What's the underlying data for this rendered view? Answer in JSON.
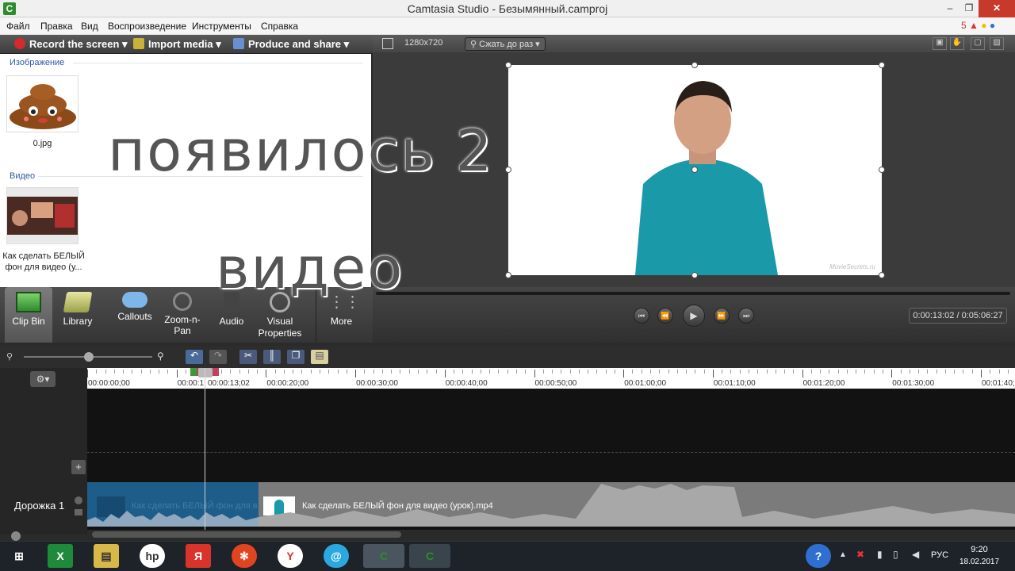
{
  "window": {
    "title": "Camtasia Studio - Безымянный.camproj",
    "logo_letter": "C"
  },
  "menu": {
    "items": [
      "Файл",
      "Правка",
      "Вид",
      "Воспроизведение",
      "Инструменты",
      "Справка"
    ],
    "notify_count": "5"
  },
  "toolbar": {
    "record_label": "Record the screen",
    "import_label": "Import media",
    "produce_label": "Produce and share"
  },
  "clip_bin": {
    "section_images": "Изображение",
    "image_caption": "0.jpg",
    "section_video": "Видео",
    "video_caption_line1": "Как сделать БЕЛЫЙ",
    "video_caption_line2": "фон для видео (у..."
  },
  "preview": {
    "size_label": "1280x720",
    "zoom_label": "Сжать до раз",
    "watermark": "MovieSecrets.ru"
  },
  "tasks": {
    "items": [
      {
        "label": "Clip Bin",
        "icon": "film-icon"
      },
      {
        "label": "Library",
        "icon": "folder-icon"
      },
      {
        "label": "Callouts",
        "icon": "speech-bubble-icon"
      },
      {
        "label": "Zoom-n-Pan",
        "label2": "Pan",
        "icon": "magnifier-icon"
      },
      {
        "label": "Audio",
        "icon": "speaker-icon"
      },
      {
        "label": "Visual",
        "label2": "Properties",
        "icon": "visual-properties-icon"
      },
      {
        "label": "More",
        "icon": "more-icon"
      }
    ]
  },
  "player": {
    "time_display": "0:00:13:02 / 0:05:06:27"
  },
  "timeline": {
    "ticks": [
      "00:00:00;00",
      "00:00:1",
      "00:00:20;00",
      "00:00:30;00",
      "00:00:40;00",
      "00:00:50;00",
      "00:01:00;00",
      "00:01:10;00",
      "00:01:20;00",
      "00:01:30;00",
      "00:01:40;0"
    ],
    "playhead_time": "00:00:13;02",
    "track_name": "Дорожка 1",
    "clip1_label": "Как сделать БЕЛЫЙ фон для в",
    "clip2_label": "Как сделать БЕЛЫЙ фон для видео (урок).mp4"
  },
  "overlay": {
    "line1": "появилось 2",
    "line2": "видео"
  },
  "taskbar": {
    "tray_lang": "РУС",
    "time": "9:20",
    "date": "18.02.2017"
  }
}
